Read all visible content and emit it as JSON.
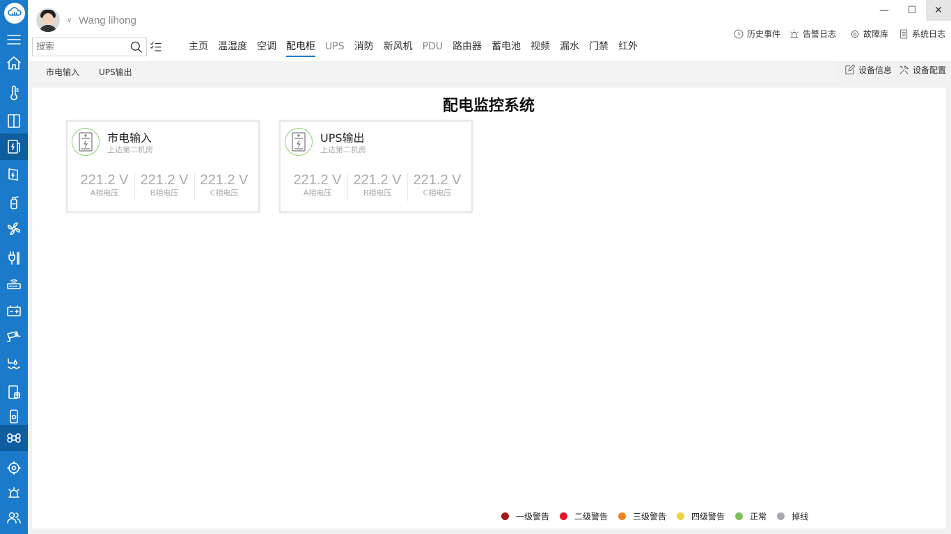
{
  "user": {
    "name": "Wang lihong"
  },
  "search": {
    "placeholder": "搜索"
  },
  "window_controls": {
    "minimize": "—",
    "maximize": "☐",
    "close": "✕"
  },
  "top_tabs": [
    {
      "label": "主页",
      "state": "normal"
    },
    {
      "label": "温湿度",
      "state": "normal"
    },
    {
      "label": "空调",
      "state": "normal"
    },
    {
      "label": "配电柜",
      "state": "active"
    },
    {
      "label": "UPS",
      "state": "dim"
    },
    {
      "label": "消防",
      "state": "normal"
    },
    {
      "label": "新风机",
      "state": "normal"
    },
    {
      "label": "PDU",
      "state": "dim"
    },
    {
      "label": "路由器",
      "state": "normal"
    },
    {
      "label": "蓄电池",
      "state": "normal"
    },
    {
      "label": "视频",
      "state": "normal"
    },
    {
      "label": "漏水",
      "state": "normal"
    },
    {
      "label": "门禁",
      "state": "normal"
    },
    {
      "label": "红外",
      "state": "normal"
    }
  ],
  "top_links": {
    "history": "历史事件",
    "alarm_log": "告警日志",
    "fault_db": "故障库",
    "system_log": "系统日志"
  },
  "sub_tabs": [
    "市电输入",
    "UPS输出"
  ],
  "side_actions": {
    "device_info": "设备信息",
    "device_config": "设备配置"
  },
  "page_title": "配电监控系统",
  "cards": [
    {
      "title": "市电输入",
      "location": "上达第二机房",
      "readings": [
        {
          "value": "221.2 V",
          "label": "A相电压"
        },
        {
          "value": "221.2 V",
          "label": "B相电压"
        },
        {
          "value": "221.2 V",
          "label": "C相电压"
        }
      ]
    },
    {
      "title": "UPS输出",
      "location": "上达第二机房",
      "readings": [
        {
          "value": "221.2 V",
          "label": "A相电压"
        },
        {
          "value": "221.2 V",
          "label": "B相电压"
        },
        {
          "value": "221.2 V",
          "label": "C相电压"
        }
      ]
    }
  ],
  "legend": [
    {
      "label": "一级警告",
      "color": "#a3161a"
    },
    {
      "label": "二级警告",
      "color": "#e8152a"
    },
    {
      "label": "三级警告",
      "color": "#f08421"
    },
    {
      "label": "四级警告",
      "color": "#f2d23c"
    },
    {
      "label": "正常",
      "color": "#7dbf5a"
    },
    {
      "label": "掉线",
      "color": "#a9a9b0"
    }
  ],
  "sidebar_icons": [
    "menu-icon",
    "home-icon",
    "thermometer-icon",
    "air-conditioner-icon",
    "power-cabinet-icon",
    "ups-icon",
    "fire-extinguisher-icon",
    "fan-icon",
    "pdu-plug-icon",
    "router-icon",
    "battery-icon",
    "camera-icon",
    "water-leak-icon",
    "door-access-icon",
    "infrared-icon",
    "apps-icon",
    "settings-icon",
    "alarm-icon",
    "users-icon"
  ]
}
